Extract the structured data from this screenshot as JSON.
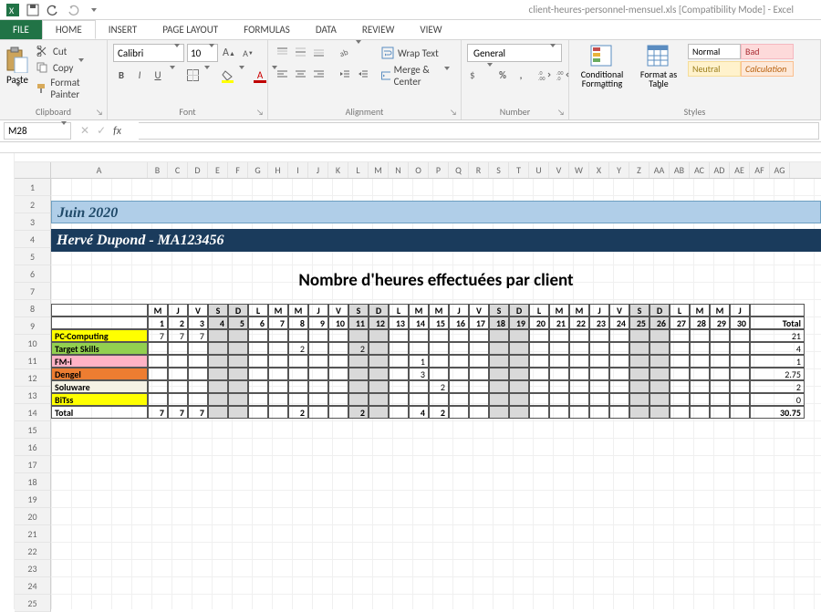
{
  "title": "client-heures-personnel-mensuel.xls [Compatibility Mode] - Excel",
  "tabs": {
    "file": "FILE",
    "home": "HOME",
    "insert": "INSERT",
    "pagelayout": "PAGE LAYOUT",
    "formulas": "FORMULAS",
    "data": "DATA",
    "review": "REVIEW",
    "view": "VIEW"
  },
  "ribbon": {
    "clipboard": {
      "label": "Clipboard",
      "paste": "Paste",
      "cut": "Cut",
      "copy": "Copy",
      "formatp": "Format Painter"
    },
    "font": {
      "label": "Font",
      "name": "Calibri",
      "size": "10"
    },
    "alignment": {
      "label": "Alignment",
      "wrap": "Wrap Text",
      "merge": "Merge & Center"
    },
    "number": {
      "label": "Number",
      "general": "General"
    },
    "styles": {
      "label": "Styles",
      "cond": "Conditional Formatting",
      "table": "Format as Table",
      "normal": "Normal",
      "bad": "Bad",
      "neutral": "Neutral",
      "calc": "Calculation"
    }
  },
  "formula": {
    "name": "M28"
  },
  "cols": [
    "A",
    "B",
    "C",
    "D",
    "E",
    "F",
    "G",
    "H",
    "I",
    "J",
    "K",
    "L",
    "M",
    "N",
    "O",
    "P",
    "Q",
    "R",
    "S",
    "T",
    "U",
    "V",
    "W",
    "X",
    "Y",
    "Z",
    "AA",
    "AB",
    "AC",
    "AD",
    "AE",
    "AF",
    "AG"
  ],
  "rows": [
    "1",
    "2",
    "3",
    "4",
    "5",
    "6",
    "7",
    "8",
    "9",
    "10",
    "11",
    "12",
    "13",
    "14",
    "15",
    "16",
    "17",
    "18",
    "19",
    "20",
    "21",
    "22",
    "23",
    "24",
    "25"
  ],
  "sheet": {
    "month": "Juin 2020",
    "person": "Hervé Dupond -  MA123456",
    "title": "Nombre d'heures effectuées par client",
    "dow": [
      "M",
      "J",
      "V",
      "S",
      "D",
      "L",
      "M",
      "M",
      "J",
      "V",
      "S",
      "D",
      "L",
      "M",
      "M",
      "J",
      "V",
      "S",
      "D",
      "L",
      "M",
      "M",
      "J",
      "V",
      "S",
      "D",
      "L",
      "M",
      "M",
      "J"
    ],
    "daynums": [
      "1",
      "2",
      "3",
      "4",
      "5",
      "6",
      "7",
      "8",
      "9",
      "10",
      "11",
      "12",
      "13",
      "14",
      "15",
      "16",
      "17",
      "18",
      "19",
      "20",
      "21",
      "22",
      "23",
      "24",
      "25",
      "26",
      "27",
      "28",
      "29",
      "30"
    ],
    "weekend_idx": [
      3,
      4,
      10,
      11,
      17,
      18,
      24,
      25
    ],
    "total_label": "Total",
    "clients": [
      {
        "name": "PC-Computing",
        "class": "client-pc",
        "cells": {
          "0": "7",
          "1": "7",
          "2": "7"
        },
        "total": "21"
      },
      {
        "name": "Target Skills",
        "class": "client-ts",
        "cells": {
          "7": "2",
          "10": "2"
        },
        "total": "4"
      },
      {
        "name": "FM-i",
        "class": "client-fm",
        "cells": {
          "13": "1"
        },
        "total": "1"
      },
      {
        "name": "Dengel",
        "class": "client-de",
        "cells": {
          "13": "3"
        },
        "total": "2.75"
      },
      {
        "name": "Soluware",
        "class": "client-so",
        "cells": {
          "14": "2"
        },
        "total": "2"
      },
      {
        "name": "BiTss",
        "class": "client-bi",
        "cells": {},
        "total": "0"
      }
    ],
    "totals_row": {
      "name": "Total",
      "cells": {
        "0": "7",
        "1": "7",
        "2": "7",
        "7": "2",
        "10": "2",
        "13": "4",
        "14": "2"
      },
      "total": "30.75"
    }
  }
}
